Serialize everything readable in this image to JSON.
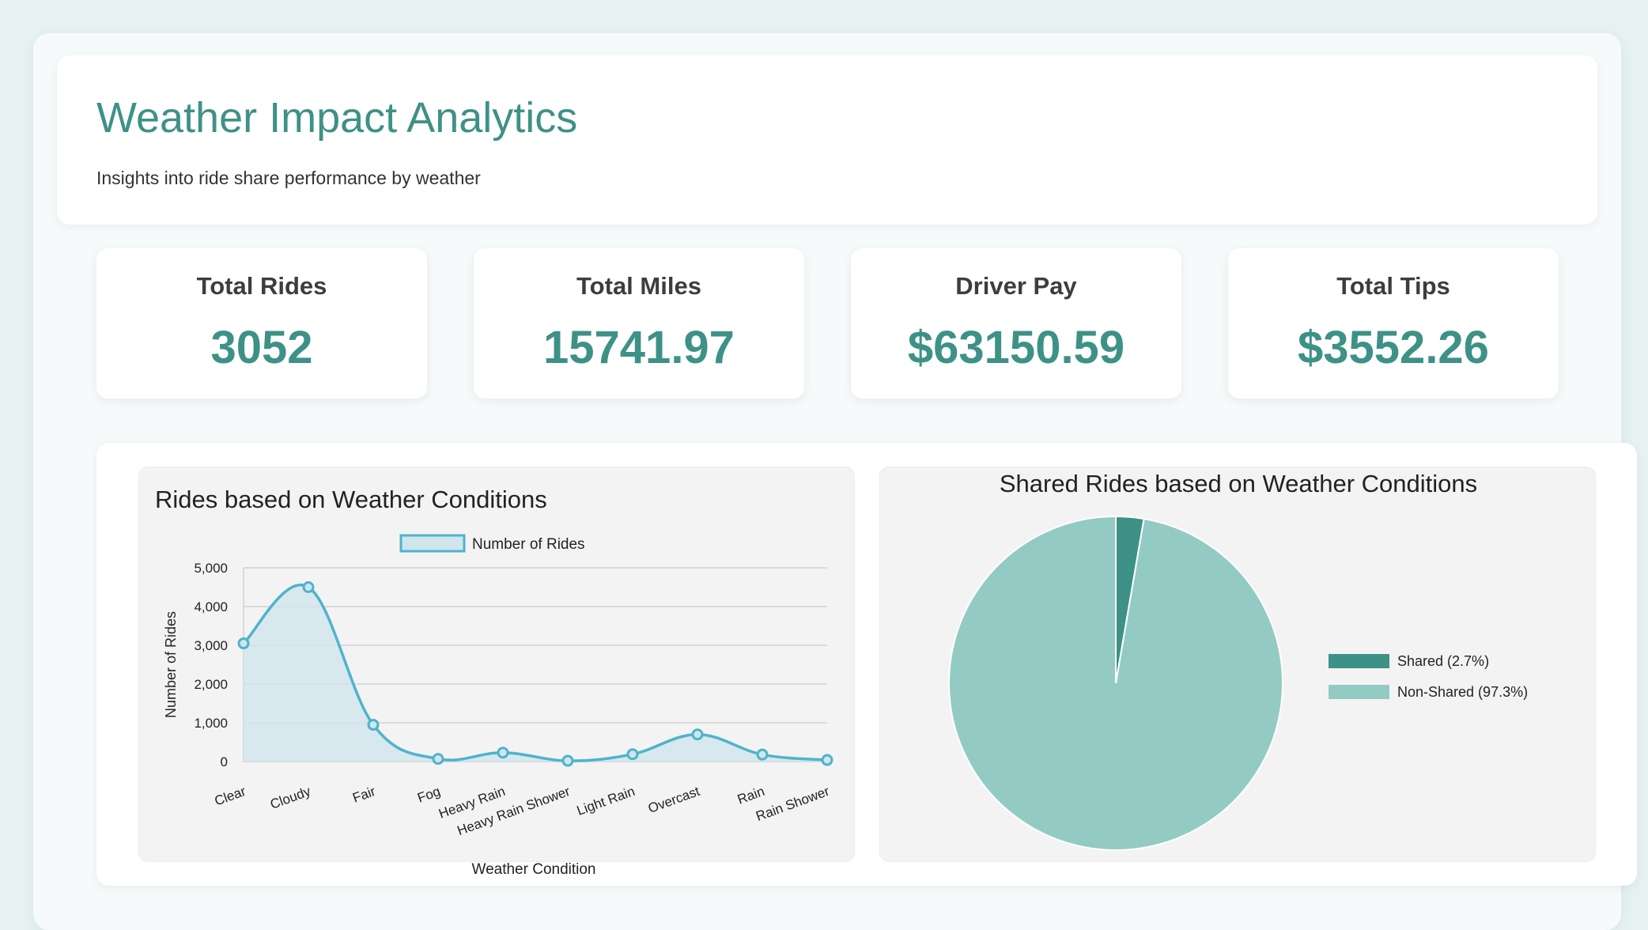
{
  "header": {
    "title": "Weather Impact Analytics",
    "subtitle": "Insights into ride share performance by weather"
  },
  "kpis": [
    {
      "label": "Total Rides",
      "value": "3052"
    },
    {
      "label": "Total Miles",
      "value": "15741.97"
    },
    {
      "label": "Driver Pay",
      "value": "$63150.59"
    },
    {
      "label": "Total Tips",
      "value": "$3552.26"
    }
  ],
  "colors": {
    "accent": "#3e9186",
    "line": "#4fb3cc",
    "area": "#cfe6ec",
    "pie_shared": "#3e9186",
    "pie_non_shared": "#93cbc4"
  },
  "chart_data": [
    {
      "type": "area",
      "title": "Rides based on Weather Conditions",
      "xlabel": "Weather Condition",
      "ylabel": "Number of Rides",
      "ylim": [
        0,
        5000
      ],
      "yticks": [
        "0",
        "1,000",
        "2,000",
        "3,000",
        "4,000",
        "5,000"
      ],
      "categories": [
        "Clear",
        "Cloudy",
        "Fair",
        "Fog",
        "Heavy Rain",
        "Heavy Rain Shower",
        "Light Rain",
        "Overcast",
        "Rain",
        "Rain Shower"
      ],
      "series": [
        {
          "name": "Number of Rides",
          "values": [
            3050,
            4500,
            950,
            70,
            230,
            20,
            190,
            700,
            180,
            40
          ]
        }
      ],
      "legend": "top-center",
      "grid": true
    },
    {
      "type": "pie",
      "title": "Shared Rides based on Weather Conditions",
      "labels": [
        "Shared (2.7%)",
        "Non-Shared (97.3%)"
      ],
      "values": [
        2.7,
        97.3
      ],
      "legend": "right"
    }
  ]
}
